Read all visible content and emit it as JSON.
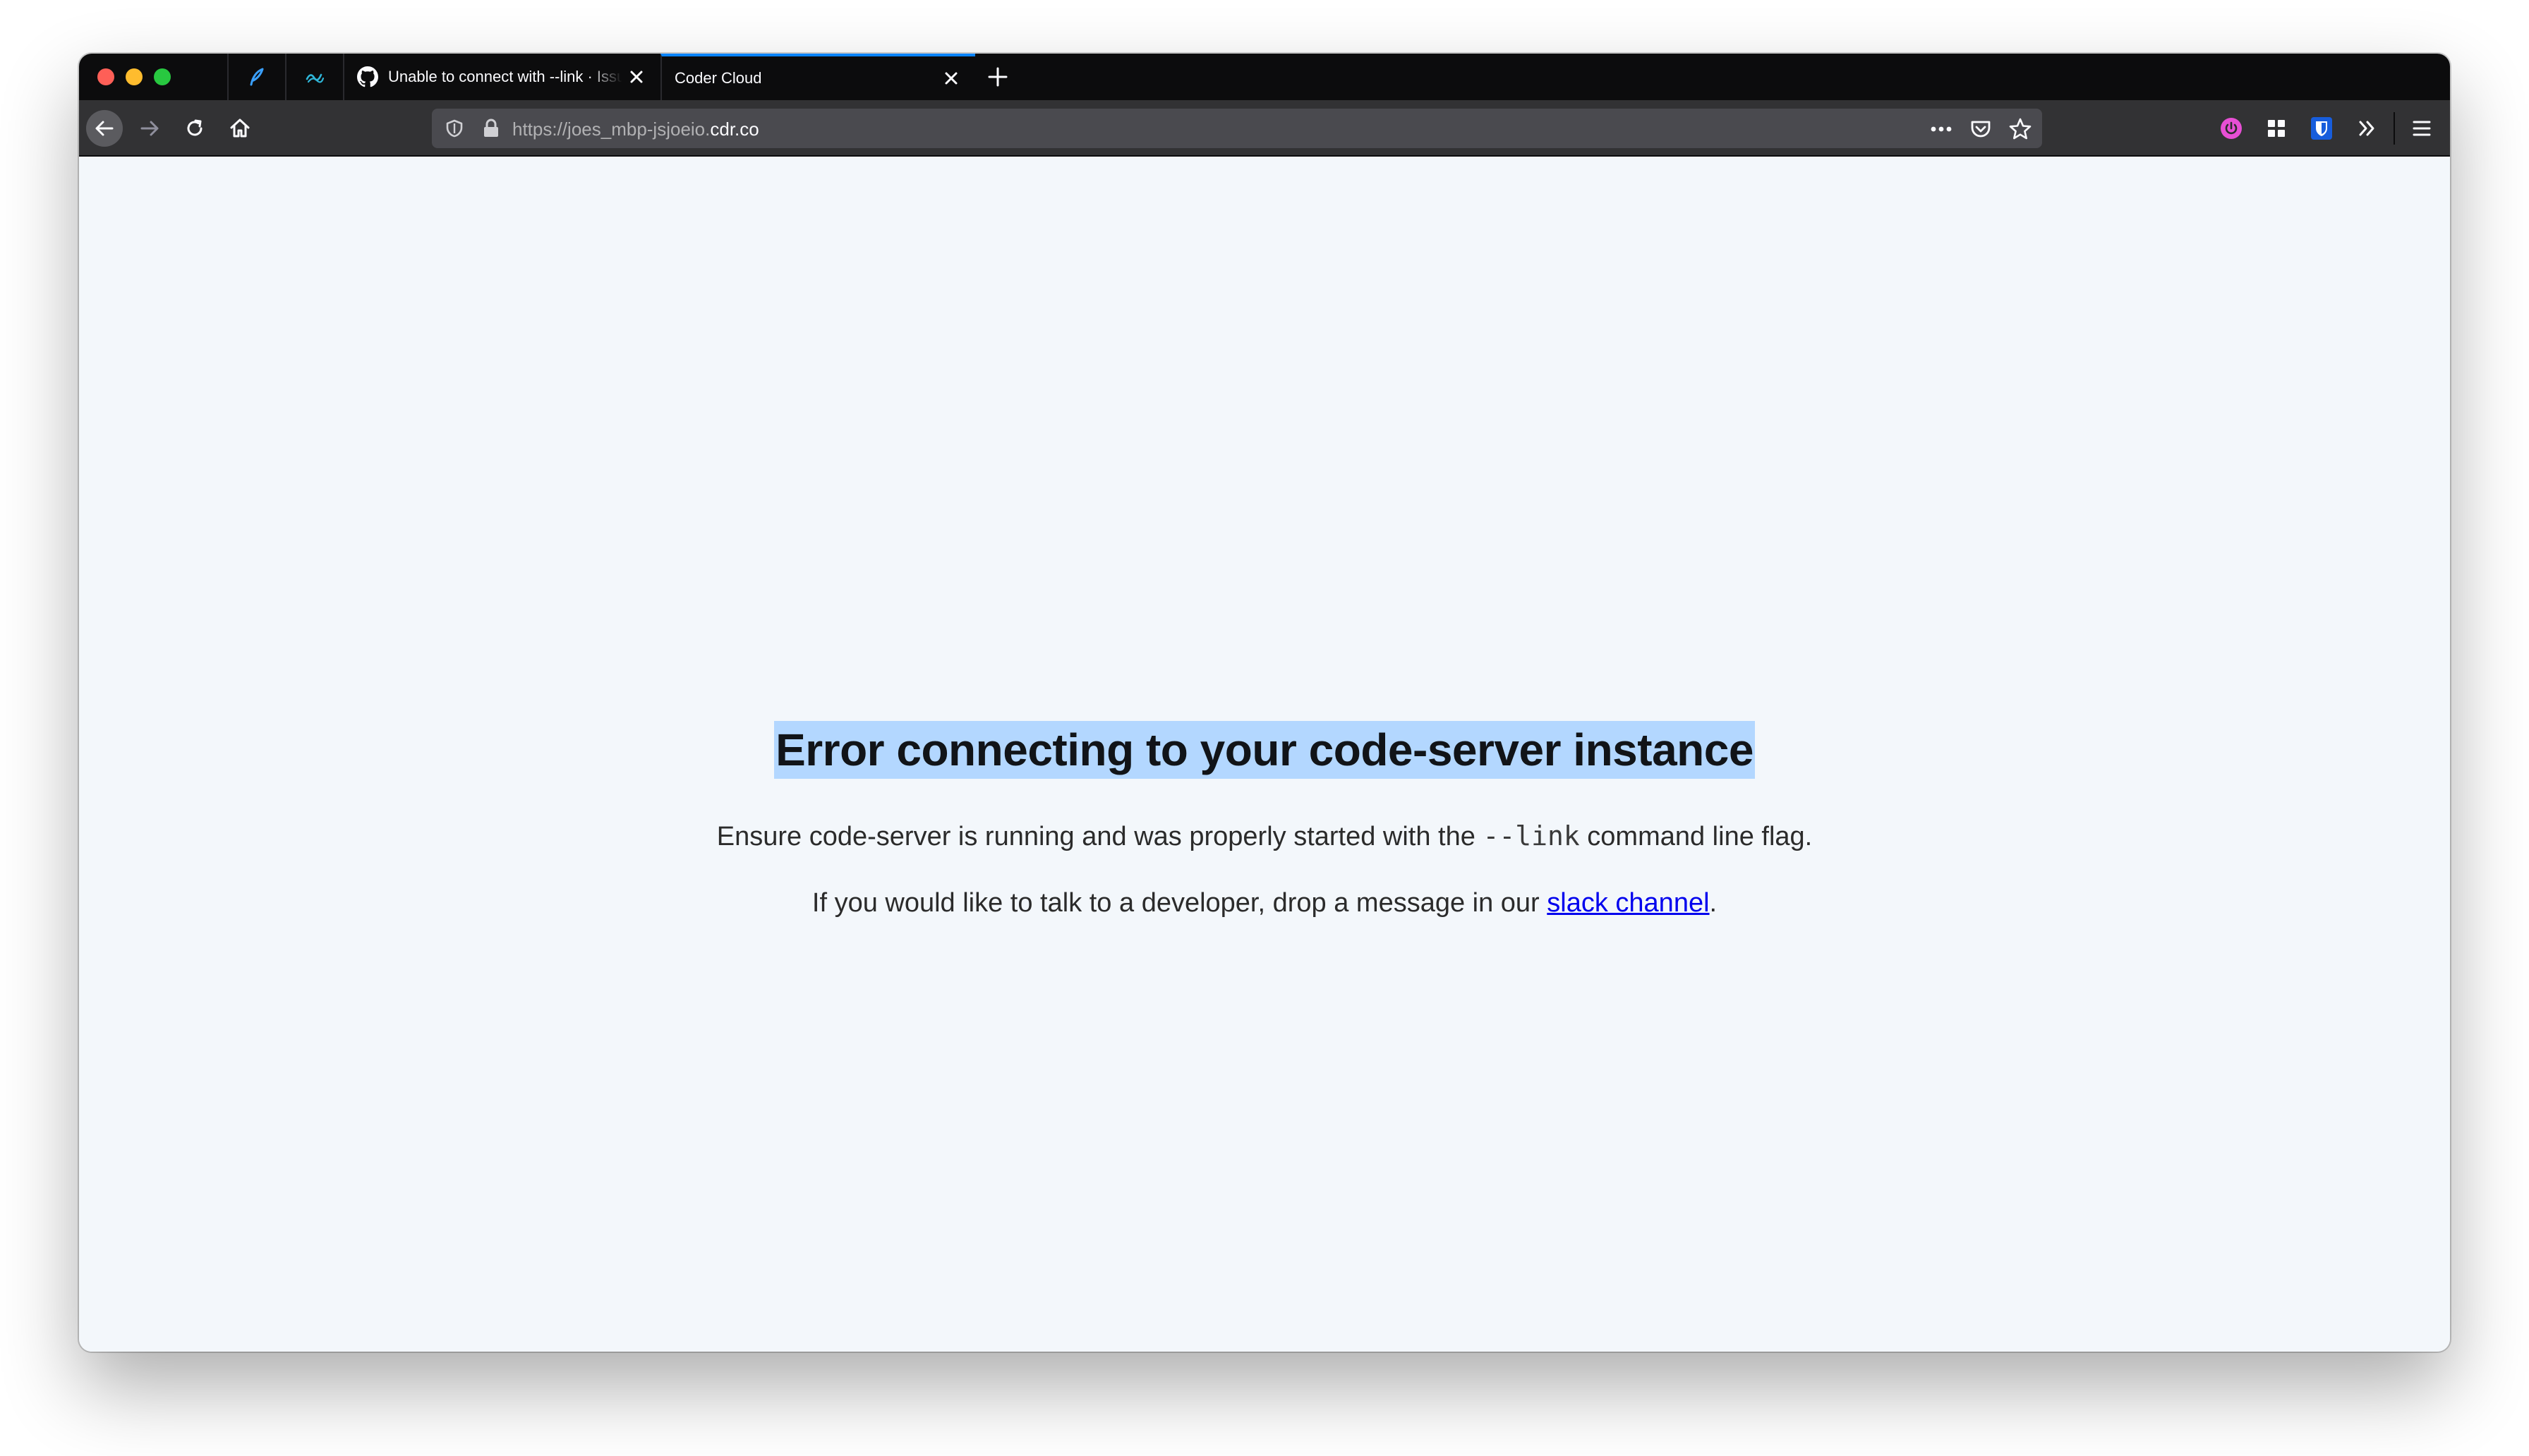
{
  "browser": {
    "pinned_tabs": [
      {
        "icon": "feather-icon"
      },
      {
        "icon": "wave-icon"
      }
    ],
    "tabs": [
      {
        "title": "Unable to connect with --link · Issue",
        "icon": "github-icon",
        "active": false
      },
      {
        "title": "Coder Cloud",
        "active": true
      }
    ],
    "url": {
      "prefix": "https://joes_mbp-jsjoeio.",
      "domain": "cdr.co"
    },
    "colors": {
      "accent": "#0a84ff",
      "tabstrip": "#0c0c0d",
      "toolbar": "#323234",
      "page_bg": "#f3f7fb",
      "selection": "#b3d7ff",
      "link": "#0000ee"
    }
  },
  "page": {
    "title": "Error connecting to your code-server instance",
    "line1_before": "Ensure code-server is running and was properly started with the ",
    "line1_code": "--link",
    "line1_after": " command line flag.",
    "line2_before": "If you would like to talk to a developer, drop a message in our ",
    "line2_link": "slack channel",
    "line2_after": "."
  }
}
